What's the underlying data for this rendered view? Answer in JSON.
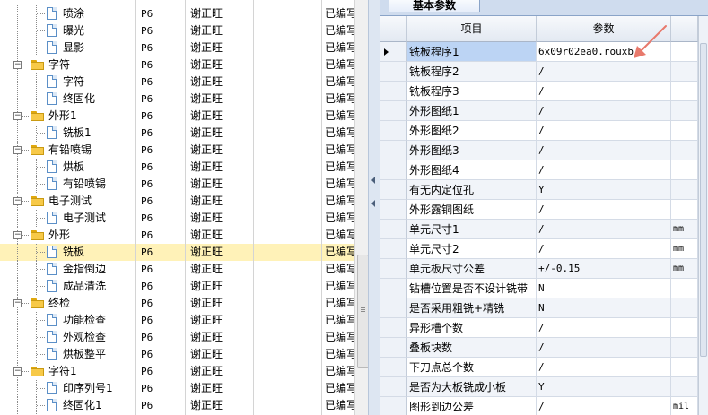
{
  "tree": {
    "rows": [
      {
        "indent": 1,
        "kind": "doc",
        "name": "喷涂",
        "code": "P6",
        "person": "谢正旺",
        "status": "已编写"
      },
      {
        "indent": 1,
        "kind": "doc",
        "name": "曝光",
        "code": "P6",
        "person": "谢正旺",
        "status": "已编写"
      },
      {
        "indent": 1,
        "kind": "doc",
        "name": "显影",
        "code": "P6",
        "person": "谢正旺",
        "status": "已编写"
      },
      {
        "indent": 0,
        "kind": "folder",
        "name": "字符",
        "code": "P6",
        "person": "谢正旺",
        "status": "已编写"
      },
      {
        "indent": 1,
        "kind": "doc",
        "name": "字符",
        "code": "P6",
        "person": "谢正旺",
        "status": "已编写"
      },
      {
        "indent": 1,
        "kind": "doc",
        "name": "终固化",
        "code": "P6",
        "person": "谢正旺",
        "status": "已编写"
      },
      {
        "indent": 0,
        "kind": "folder",
        "name": "外形1",
        "code": "P6",
        "person": "谢正旺",
        "status": "已编写"
      },
      {
        "indent": 1,
        "kind": "doc",
        "name": "铣板1",
        "code": "P6",
        "person": "谢正旺",
        "status": "已编写"
      },
      {
        "indent": 0,
        "kind": "folder",
        "name": "有铅喷锡",
        "code": "P6",
        "person": "谢正旺",
        "status": "已编写"
      },
      {
        "indent": 1,
        "kind": "doc",
        "name": "烘板",
        "code": "P6",
        "person": "谢正旺",
        "status": "已编写"
      },
      {
        "indent": 1,
        "kind": "doc",
        "name": "有铅喷锡",
        "code": "P6",
        "person": "谢正旺",
        "status": "已编写"
      },
      {
        "indent": 0,
        "kind": "folder",
        "name": "电子测试",
        "code": "P6",
        "person": "谢正旺",
        "status": "已编写"
      },
      {
        "indent": 1,
        "kind": "doc",
        "name": "电子测试",
        "code": "P6",
        "person": "谢正旺",
        "status": "已编写"
      },
      {
        "indent": 0,
        "kind": "folder",
        "name": "外形",
        "code": "P6",
        "person": "谢正旺",
        "status": "已编写"
      },
      {
        "indent": 1,
        "kind": "doc",
        "name": "铣板",
        "code": "P6",
        "person": "谢正旺",
        "status": "已编写",
        "selected": true
      },
      {
        "indent": 1,
        "kind": "doc",
        "name": "金指倒边",
        "code": "P6",
        "person": "谢正旺",
        "status": "已编写"
      },
      {
        "indent": 1,
        "kind": "doc",
        "name": "成品清洗",
        "code": "P6",
        "person": "谢正旺",
        "status": "已编写"
      },
      {
        "indent": 0,
        "kind": "folder",
        "name": "终检",
        "code": "P6",
        "person": "谢正旺",
        "status": "已编写"
      },
      {
        "indent": 1,
        "kind": "doc",
        "name": "功能检查",
        "code": "P6",
        "person": "谢正旺",
        "status": "已编写"
      },
      {
        "indent": 1,
        "kind": "doc",
        "name": "外观检查",
        "code": "P6",
        "person": "谢正旺",
        "status": "已编写"
      },
      {
        "indent": 1,
        "kind": "doc",
        "name": "烘板整平",
        "code": "P6",
        "person": "谢正旺",
        "status": "已编写"
      },
      {
        "indent": 0,
        "kind": "folder",
        "name": "字符1",
        "code": "P6",
        "person": "谢正旺",
        "status": "已编写"
      },
      {
        "indent": 1,
        "kind": "doc",
        "name": "印序列号1",
        "code": "P6",
        "person": "谢正旺",
        "status": "已编写"
      },
      {
        "indent": 1,
        "kind": "doc",
        "name": "终固化1",
        "code": "P6",
        "person": "谢正旺",
        "status": "已编写"
      }
    ]
  },
  "panel": {
    "tab_label": "基本参数",
    "columns": {
      "item": "项目",
      "param": "参数"
    },
    "rows": [
      {
        "item": "铣板程序1",
        "value": "6x09r02ea0.rouxb",
        "unit": "",
        "current": true
      },
      {
        "item": "铣板程序2",
        "value": "/",
        "unit": ""
      },
      {
        "item": "铣板程序3",
        "value": "/",
        "unit": ""
      },
      {
        "item": "外形图纸1",
        "value": "/",
        "unit": ""
      },
      {
        "item": "外形图纸2",
        "value": "/",
        "unit": ""
      },
      {
        "item": "外形图纸3",
        "value": "/",
        "unit": ""
      },
      {
        "item": "外形图纸4",
        "value": "/",
        "unit": ""
      },
      {
        "item": "有无内定位孔",
        "value": "Y",
        "unit": ""
      },
      {
        "item": "外形露铜图纸",
        "value": "/",
        "unit": ""
      },
      {
        "item": "单元尺寸1",
        "value": "/",
        "unit": "mm"
      },
      {
        "item": "单元尺寸2",
        "value": "/",
        "unit": "mm"
      },
      {
        "item": "单元板尺寸公差",
        "value": "+/-0.15",
        "unit": "mm"
      },
      {
        "item": "钻槽位置是否不设计铣带",
        "value": "N",
        "unit": ""
      },
      {
        "item": "是否采用粗铣+精铣",
        "value": "N",
        "unit": ""
      },
      {
        "item": "异形槽个数",
        "value": "/",
        "unit": ""
      },
      {
        "item": "叠板块数",
        "value": "/",
        "unit": ""
      },
      {
        "item": "下刀点总个数",
        "value": "/",
        "unit": ""
      },
      {
        "item": "是否为大板铣成小板",
        "value": "Y",
        "unit": ""
      },
      {
        "item": "图形到边公差",
        "value": "/",
        "unit": "mil"
      }
    ]
  },
  "annotation": {
    "arrow_color": "#e8796c"
  },
  "colors": {
    "folder": "#f7c948",
    "selected_row": "#fff2b8",
    "current_cell": "#bcd4f4"
  },
  "icons": [
    "folder-icon",
    "document-icon",
    "expander-minus-icon",
    "row-indicator-icon",
    "red-arrow-annotation"
  ]
}
